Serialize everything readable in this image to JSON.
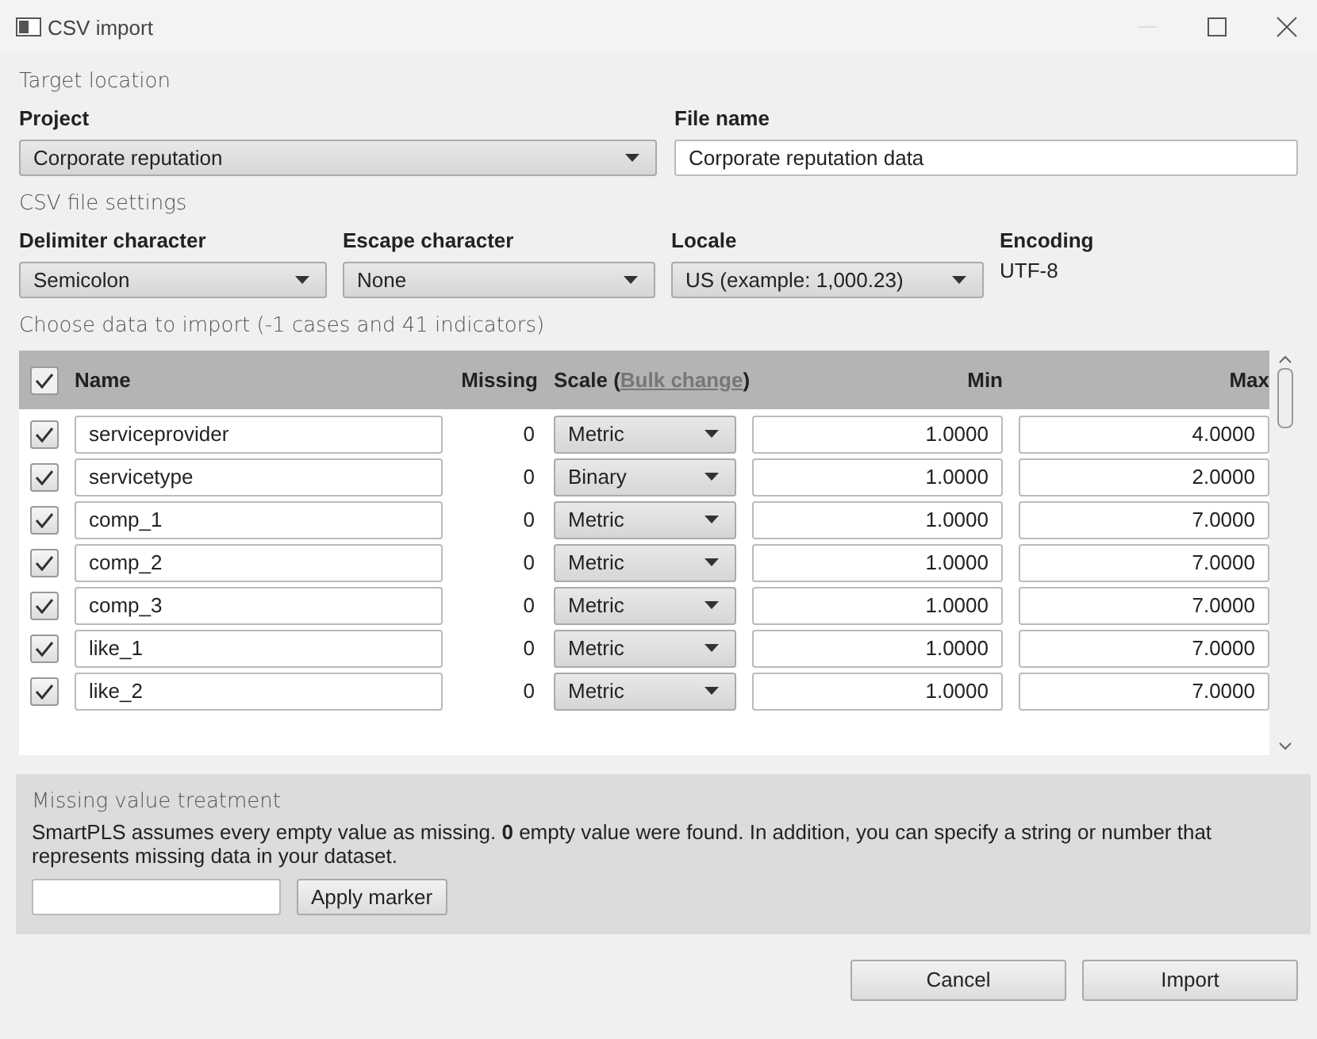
{
  "window": {
    "title": "CSV import"
  },
  "target_location": {
    "heading": "Target location",
    "project": {
      "label": "Project",
      "value": "Corporate reputation"
    },
    "file_name": {
      "label": "File name",
      "value": "Corporate reputation data"
    }
  },
  "csv_settings": {
    "heading": "CSV file settings",
    "fields": [
      {
        "label": "Delimiter character",
        "kind": "select",
        "value": "Semicolon"
      },
      {
        "label": "Escape character",
        "kind": "select",
        "value": "None"
      },
      {
        "label": "Locale",
        "kind": "select",
        "value": "US (example: 1,000.23)"
      },
      {
        "label": "Encoding",
        "kind": "text",
        "value": "UTF-8"
      }
    ]
  },
  "import_data": {
    "heading": "Choose data to import (-1 cases and 41 indicators)",
    "all_checked": true,
    "columns": {
      "name": "Name",
      "missing": "Missing",
      "scale": "Scale (",
      "bulk_change": "Bulk change",
      "scale_end": ")",
      "min": "Min",
      "max": "Max"
    },
    "rows": [
      {
        "checked": true,
        "name": "serviceprovider",
        "missing": "0",
        "scale": "Metric",
        "min": "1.0000",
        "max": "4.0000"
      },
      {
        "checked": true,
        "name": "servicetype",
        "missing": "0",
        "scale": "Binary",
        "min": "1.0000",
        "max": "2.0000"
      },
      {
        "checked": true,
        "name": "comp_1",
        "missing": "0",
        "scale": "Metric",
        "min": "1.0000",
        "max": "7.0000"
      },
      {
        "checked": true,
        "name": "comp_2",
        "missing": "0",
        "scale": "Metric",
        "min": "1.0000",
        "max": "7.0000"
      },
      {
        "checked": true,
        "name": "comp_3",
        "missing": "0",
        "scale": "Metric",
        "min": "1.0000",
        "max": "7.0000"
      },
      {
        "checked": true,
        "name": "like_1",
        "missing": "0",
        "scale": "Metric",
        "min": "1.0000",
        "max": "7.0000"
      },
      {
        "checked": true,
        "name": "like_2",
        "missing": "0",
        "scale": "Metric",
        "min": "1.0000",
        "max": "7.0000"
      }
    ]
  },
  "missing_treatment": {
    "heading": "Missing value treatment",
    "text": "SmartPLS assumes every empty value as missing. **0** empty value were found. In addition, you can specify a string or number that represents missing data in your dataset.",
    "button": "Apply marker"
  },
  "buttons": [
    "Cancel",
    "Import"
  ]
}
